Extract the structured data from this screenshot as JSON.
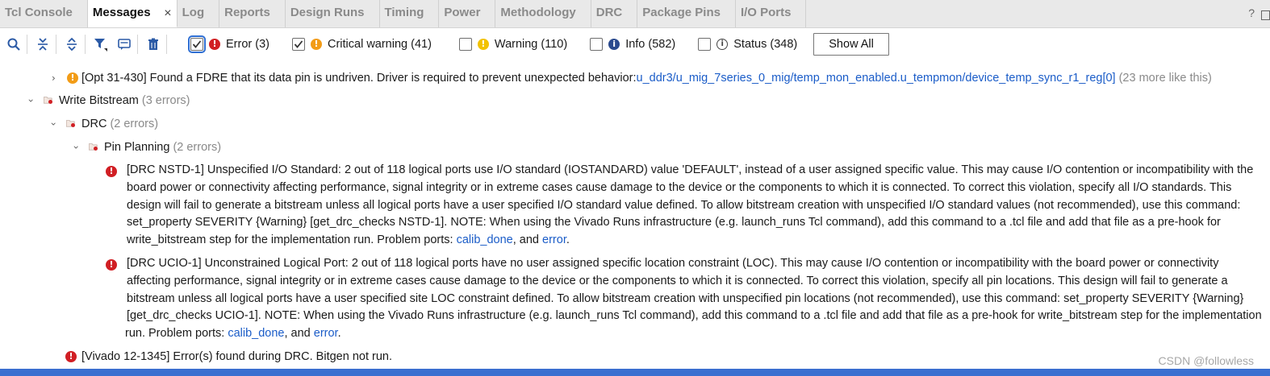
{
  "tabs": [
    {
      "label": "Tcl Console",
      "active": false
    },
    {
      "label": "Messages",
      "active": true,
      "close": "×"
    },
    {
      "label": "Log",
      "active": false
    },
    {
      "label": "Reports",
      "active": false
    },
    {
      "label": "Design Runs",
      "active": false
    },
    {
      "label": "Timing",
      "active": false
    },
    {
      "label": "Power",
      "active": false
    },
    {
      "label": "Methodology",
      "active": false
    },
    {
      "label": "DRC",
      "active": false
    },
    {
      "label": "Package Pins",
      "active": false
    },
    {
      "label": "I/O Ports",
      "active": false
    }
  ],
  "window_controls": {
    "help": "?"
  },
  "toolbar": {
    "icons": [
      "search-icon",
      "collapse-all-icon",
      "expand-all-icon",
      "filter-icon",
      "group-icon",
      "delete-icon"
    ]
  },
  "filters": [
    {
      "label": "Error (3)",
      "checked": true,
      "severity": "error"
    },
    {
      "label": "Critical warning (41)",
      "checked": true,
      "severity": "critical"
    },
    {
      "label": "Warning (110)",
      "checked": false,
      "severity": "warning"
    },
    {
      "label": "Info (582)",
      "checked": false,
      "severity": "info"
    },
    {
      "label": "Status (348)",
      "checked": false,
      "severity": "status"
    }
  ],
  "show_all_label": "Show All",
  "messages": {
    "opt": {
      "text": "[Opt 31-430] Found a FDRE that its data pin is undriven. Driver is required to prevent unexpected behavior:",
      "link": "u_ddr3/u_mig_7series_0_mig/temp_mon_enabled.u_tempmon/device_temp_sync_r1_reg[0]",
      "more": " (23 more like this)"
    },
    "write_bitstream": {
      "label": "Write Bitstream",
      "count": " (3 errors)"
    },
    "drc": {
      "label": "DRC",
      "count": " (2 errors)"
    },
    "pin_planning": {
      "label": "Pin Planning",
      "count": " (2 errors)"
    },
    "nstd": {
      "lines": [
        "[DRC NSTD-1] Unspecified I/O Standard: 2 out of 118 logical ports use I/O standard (IOSTANDARD) value 'DEFAULT', instead of a user assigned specific value. This may cause I/O contention or incompatibility with the",
        "board power or connectivity affecting performance, signal integrity or in extreme cases cause damage to the device or the components to which it is connected. To correct this violation, specify all I/O standards. This",
        "design will fail to generate a bitstream unless all logical ports have a user specified I/O standard value defined. To allow bitstream creation with unspecified I/O standard values (not recommended), use this command:",
        "set_property SEVERITY {Warning} [get_drc_checks NSTD-1]. NOTE: When using the Vivado Runs infrastructure (e.g. launch_runs Tcl command), add this command to a .tcl file and add that file as a pre-hook for"
      ],
      "last_prefix": "write_bitstream step for the implementation run. Problem ports: ",
      "port1": "calib_done",
      "and": ", and ",
      "port2": "error",
      "end": "."
    },
    "ucio": {
      "lines": [
        "[DRC UCIO-1] Unconstrained Logical Port: 2 out of 118 logical ports have no user assigned specific location constraint (LOC). This may cause I/O contention or incompatibility with the board power or connectivity",
        "affecting performance, signal integrity or in extreme cases cause damage to the device or the components to which it is connected. To correct this violation, specify all pin locations. This design will fail to generate a",
        "bitstream unless all logical ports have a user specified site LOC constraint defined. To allow bitstream creation with unspecified pin locations (not recommended), use this command: set_property SEVERITY {Warning}",
        "[get_drc_checks UCIO-1]. NOTE: When using the Vivado Runs infrastructure (e.g. launch_runs Tcl command), add this command to a .tcl file and add that file as a pre-hook for write_bitstream step for the implementation"
      ],
      "last_prefix": " run. Problem ports: ",
      "port1": "calib_done",
      "and": ", and ",
      "port2": "error",
      "end": "."
    },
    "vivado": {
      "text": "[Vivado 12-1345] Error(s) found during DRC. Bitgen not run."
    }
  },
  "watermark": "CSDN @followless",
  "colors": {
    "error": "#d11f24",
    "critical": "#f29c17",
    "warning": "#f2c200",
    "info": "#2a4a8e",
    "link": "#1a5cc8",
    "accent": "#3b6fd0"
  }
}
